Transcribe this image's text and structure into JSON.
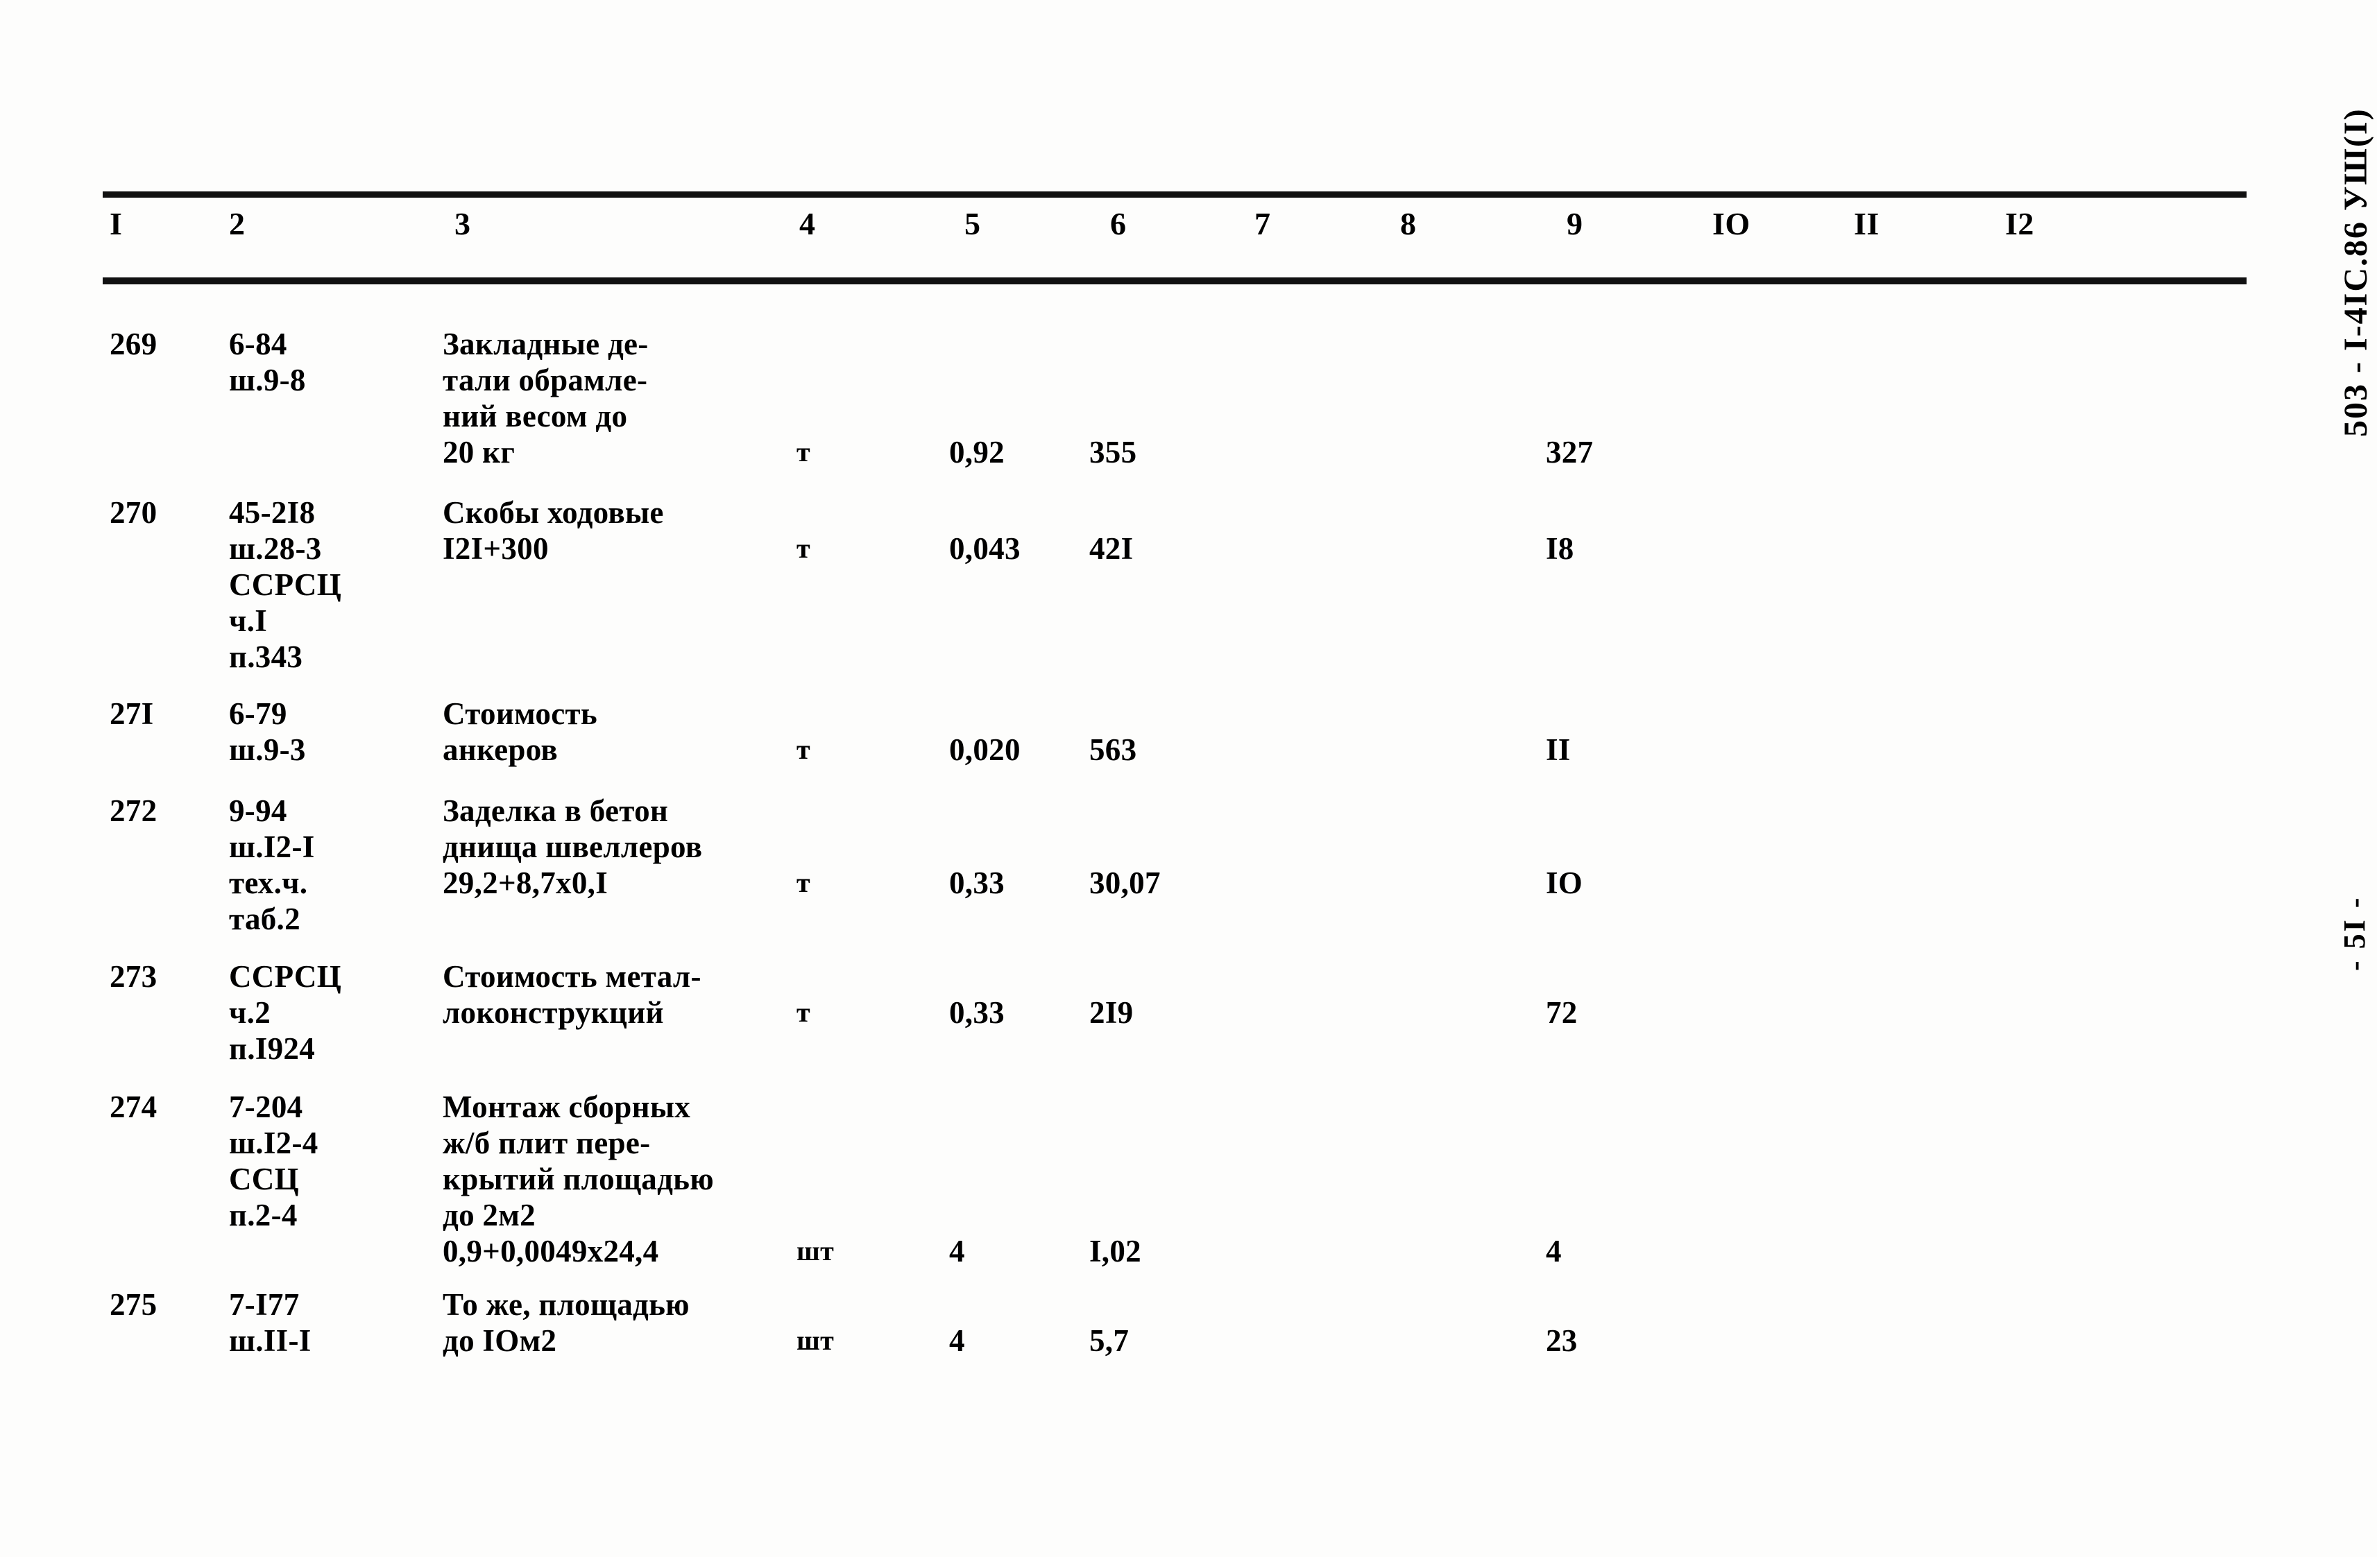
{
  "document": {
    "margin_reference": "503 - I-4IC.86  УШ(I)",
    "margin_page_number": "- 5I -"
  },
  "table": {
    "column_headers": [
      "I",
      "2",
      "3",
      "4",
      "5",
      "6",
      "7",
      "8",
      "9",
      "IO",
      "II",
      "I2"
    ],
    "rows": [
      {
        "number": "269",
        "code": "6-84\nш.9-8",
        "description": "Закладные де-\nтали обрамле-\nний весом до\n20 кг",
        "unit": "т",
        "quantity": "0,92",
        "price": "355",
        "col7": "",
        "col8": "",
        "total": "327",
        "col10": "",
        "col11": "",
        "col12": ""
      },
      {
        "number": "270",
        "code": "45-2I8\nш.28-3\nССРСЦ\nч.I\nп.343",
        "description": "Скобы ходовые\nI2I+300",
        "unit": "т",
        "quantity": "0,043",
        "price": "42I",
        "col7": "",
        "col8": "",
        "total": "I8",
        "col10": "",
        "col11": "",
        "col12": ""
      },
      {
        "number": "27I",
        "code": "6-79\nш.9-3",
        "description": "Стоимость\nанкеров",
        "unit": "т",
        "quantity": "0,020",
        "price": "563",
        "col7": "",
        "col8": "",
        "total": "II",
        "col10": "",
        "col11": "",
        "col12": ""
      },
      {
        "number": "272",
        "code": "9-94\nш.I2-I\nтех.ч.\nтаб.2",
        "description": "Заделка в бетон\nднища швеллеров\n29,2+8,7х0,I",
        "unit": "т",
        "quantity": "0,33",
        "price": "30,07",
        "col7": "",
        "col8": "",
        "total": "IO",
        "col10": "",
        "col11": "",
        "col12": ""
      },
      {
        "number": "273",
        "code": "ССРСЦ\nч.2\nп.I924",
        "description": "Стоимость метал-\nлоконструкций",
        "unit": "т",
        "quantity": "0,33",
        "price": "2I9",
        "col7": "",
        "col8": "",
        "total": "72",
        "col10": "",
        "col11": "",
        "col12": ""
      },
      {
        "number": "274",
        "code": "7-204\nш.I2-4\nССЦ\nп.2-4",
        "description": "Монтаж сборных\nж/б плит пере-\nкрытий площадью\nдо 2м2\n0,9+0,0049х24,4",
        "unit": "шт",
        "quantity": "4",
        "price": "I,02",
        "col7": "",
        "col8": "",
        "total": "4",
        "col10": "",
        "col11": "",
        "col12": ""
      },
      {
        "number": "275",
        "code": "7-I77\nш.II-I",
        "description": "То же, площадью\nдо IOм2",
        "unit": "шт",
        "quantity": "4",
        "price": "5,7",
        "col7": "",
        "col8": "",
        "total": "23",
        "col10": "",
        "col11": "",
        "col12": ""
      }
    ]
  }
}
